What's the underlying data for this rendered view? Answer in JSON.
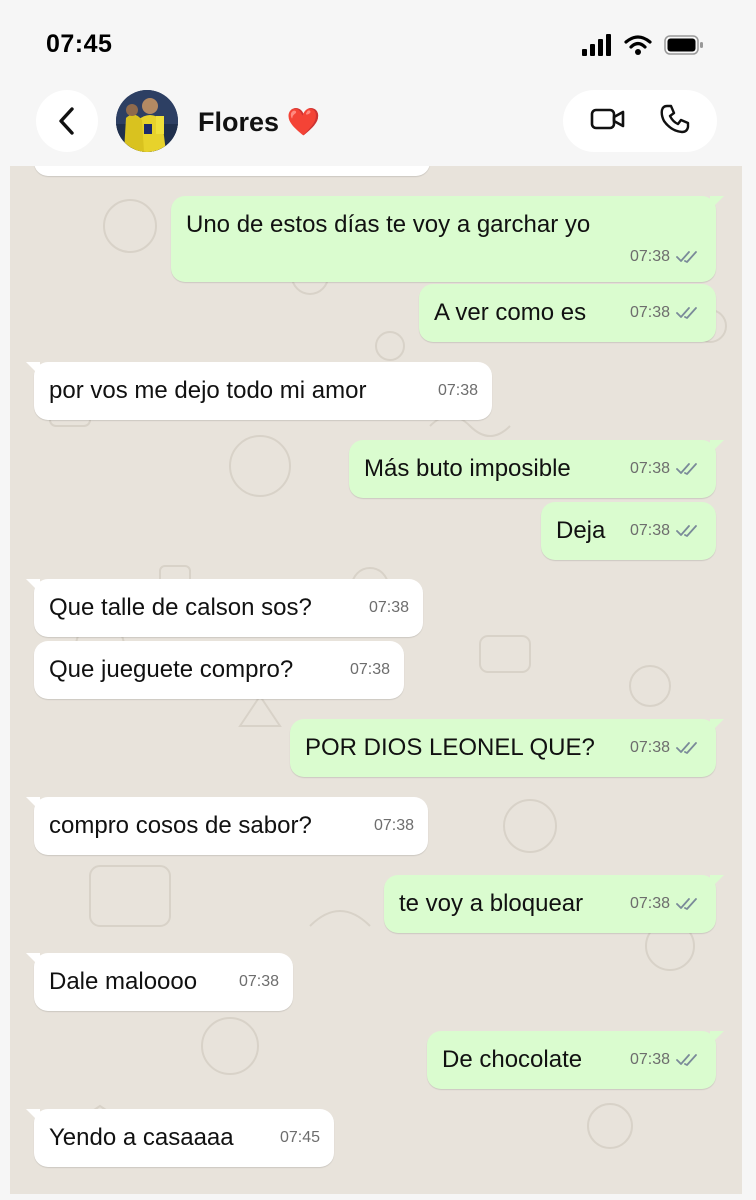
{
  "status_bar": {
    "time": "07:45"
  },
  "header": {
    "contact_name": "Flores ❤️"
  },
  "messages": [
    {
      "dir": "out",
      "text": "Uno de estos días te voy a garchar yo",
      "time": "07:38",
      "read": true
    },
    {
      "dir": "out",
      "text": "A ver como es",
      "time": "07:38",
      "read": true
    },
    {
      "dir": "in",
      "text": "por vos me dejo todo mi amor",
      "time": "07:38"
    },
    {
      "dir": "out",
      "text": "Más buto imposible",
      "time": "07:38",
      "read": true
    },
    {
      "dir": "out",
      "text": "Deja",
      "time": "07:38",
      "read": true
    },
    {
      "dir": "in",
      "text": "Que talle de calson sos?",
      "time": "07:38"
    },
    {
      "dir": "in",
      "text": "Que jueguete compro?",
      "time": "07:38"
    },
    {
      "dir": "out",
      "text": "POR DIOS LEONEL QUE?",
      "time": "07:38",
      "read": true
    },
    {
      "dir": "in",
      "text": "compro cosos de sabor?",
      "time": "07:38"
    },
    {
      "dir": "out",
      "text": "te voy a bloquear",
      "time": "07:38",
      "read": true
    },
    {
      "dir": "in",
      "text": "Dale maloooo",
      "time": "07:38"
    },
    {
      "dir": "out",
      "text": "De chocolate",
      "time": "07:38",
      "read": true
    },
    {
      "dir": "in",
      "text": "Yendo a casaaaa",
      "time": "07:45"
    }
  ],
  "colors": {
    "incoming_bubble": "#ffffff",
    "outgoing_bubble": "#dafccf",
    "chat_background": "#e8e3db",
    "read_check": "#7a8a99"
  }
}
